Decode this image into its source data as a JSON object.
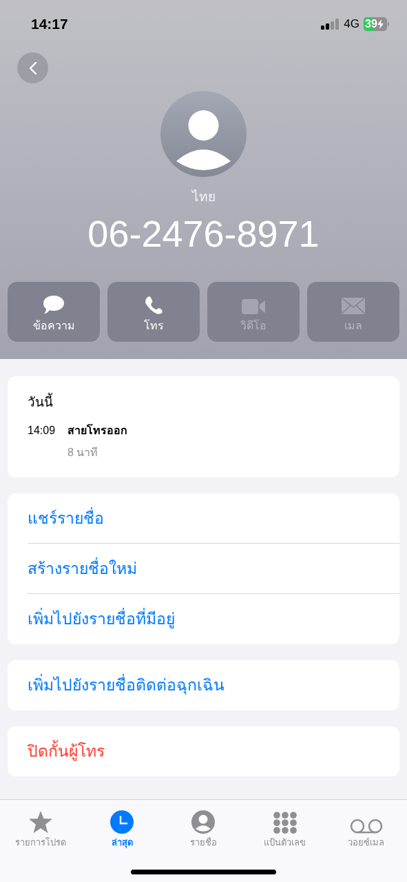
{
  "status_bar": {
    "time": "14:17",
    "network": "4G",
    "battery": "39"
  },
  "contact": {
    "label": "ไทย",
    "number": "06-2476-8971"
  },
  "actions": [
    {
      "kind": "message",
      "label": "ข้อความ",
      "disabled": false
    },
    {
      "kind": "call",
      "label": "โทร",
      "disabled": false
    },
    {
      "kind": "video",
      "label": "วิดีโอ",
      "disabled": true
    },
    {
      "kind": "mail",
      "label": "เมล",
      "disabled": true
    }
  ],
  "call_history": {
    "heading": "วันนี้",
    "calls": [
      {
        "time": "14:09",
        "type": "สายโทรออก",
        "duration": "8 นาที"
      }
    ]
  },
  "option_groups": [
    [
      {
        "label": "แชร์รายชื่อ",
        "destructive": false
      },
      {
        "label": "สร้างรายชื่อใหม่",
        "destructive": false
      },
      {
        "label": "เพิ่มไปยังรายชื่อที่มีอยู่",
        "destructive": false
      }
    ],
    [
      {
        "label": "เพิ่มไปยังรายชื่อติดต่อฉุกเฉิน",
        "destructive": false
      }
    ],
    [
      {
        "label": "ปิดกั้นผู้โทร",
        "destructive": true
      }
    ]
  ],
  "tab_bar": [
    {
      "kind": "favorites",
      "label": "รายการโปรด",
      "selected": false
    },
    {
      "kind": "recents",
      "label": "ล่าสุด",
      "selected": true
    },
    {
      "kind": "contacts",
      "label": "รายชื่อ",
      "selected": false
    },
    {
      "kind": "keypad",
      "label": "แป้นตัวเลข",
      "selected": false
    },
    {
      "kind": "voicemail",
      "label": "วอยซ์เมล",
      "selected": false
    }
  ]
}
